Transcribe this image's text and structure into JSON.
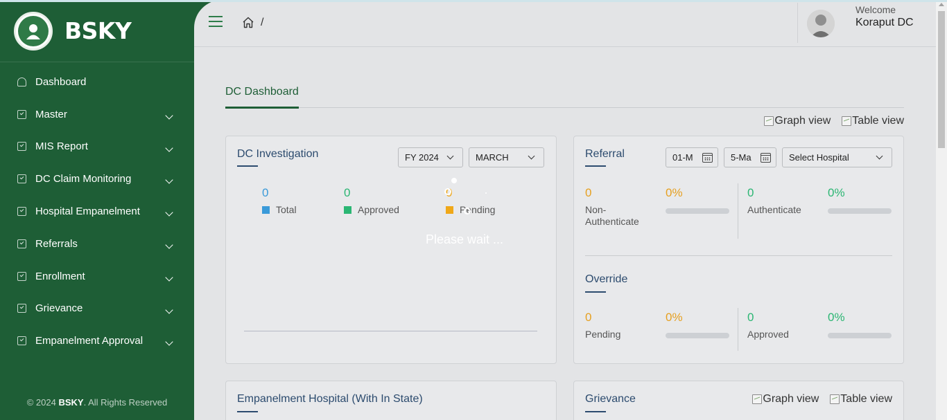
{
  "app": {
    "name": "BSKY"
  },
  "sidebar": {
    "items": [
      {
        "label": "Dashboard",
        "icon": "dashboard-icon",
        "expandable": false
      },
      {
        "label": "Master",
        "icon": "checklist-icon",
        "expandable": true
      },
      {
        "label": "MIS Report",
        "icon": "checklist-icon",
        "expandable": true
      },
      {
        "label": "DC Claim Monitoring",
        "icon": "checklist-icon",
        "expandable": true
      },
      {
        "label": "Hospital Empanelment",
        "icon": "checklist-icon",
        "expandable": true
      },
      {
        "label": "Referrals",
        "icon": "checklist-icon",
        "expandable": true
      },
      {
        "label": "Enrollment",
        "icon": "checklist-icon",
        "expandable": true
      },
      {
        "label": "Grievance",
        "icon": "checklist-icon",
        "expandable": true
      },
      {
        "label": "Empanelment Approval",
        "icon": "checklist-icon",
        "expandable": true
      }
    ],
    "footer": {
      "prefix": "© 2024",
      "brand": "BSKY",
      "suffix": ". All Rights Reserved"
    }
  },
  "header": {
    "breadcrumb_sep": "/",
    "welcome": "Welcome",
    "user_name": "Koraput DC"
  },
  "tabs": [
    {
      "label": "DC Dashboard",
      "active": true
    }
  ],
  "view_links": {
    "graph": "Graph view",
    "table": "Table view"
  },
  "dc_investigation": {
    "title": "DC Investigation",
    "fy_select": "FY 2024",
    "month_select": "MARCH",
    "stats": [
      {
        "value": "0",
        "label": "Total",
        "color": "#3a9ad9"
      },
      {
        "value": "0",
        "label": "Approved",
        "color": "#2bb673"
      },
      {
        "value": "0",
        "label": "Pending",
        "color": "#f0a818"
      }
    ],
    "loading_text": "Please wait ..."
  },
  "referral": {
    "title": "Referral",
    "from_date": "01-M",
    "to_date": "5-Ma",
    "hospital_select": "Select Hospital",
    "stats": [
      {
        "value": "0",
        "label": "Non-Authenticate",
        "percent": "0%",
        "fill": 0
      },
      {
        "value": "0",
        "label": "Authenticate",
        "percent": "0%",
        "fill": 0
      }
    ]
  },
  "override": {
    "title": "Override",
    "stats": [
      {
        "value": "0",
        "label": "Pending",
        "percent": "0%",
        "fill": 0
      },
      {
        "value": "0",
        "label": "Approved",
        "percent": "0%",
        "fill": 0
      }
    ]
  },
  "empanelment_hospital": {
    "title": "Empanelment Hospital (With In State)"
  },
  "grievance": {
    "title": "Grievance"
  },
  "colors": {
    "sidebar": "#1e5e36",
    "accent_orange": "#e6a020",
    "accent_green": "#2bb673",
    "title_blue": "#2c4b6e"
  }
}
